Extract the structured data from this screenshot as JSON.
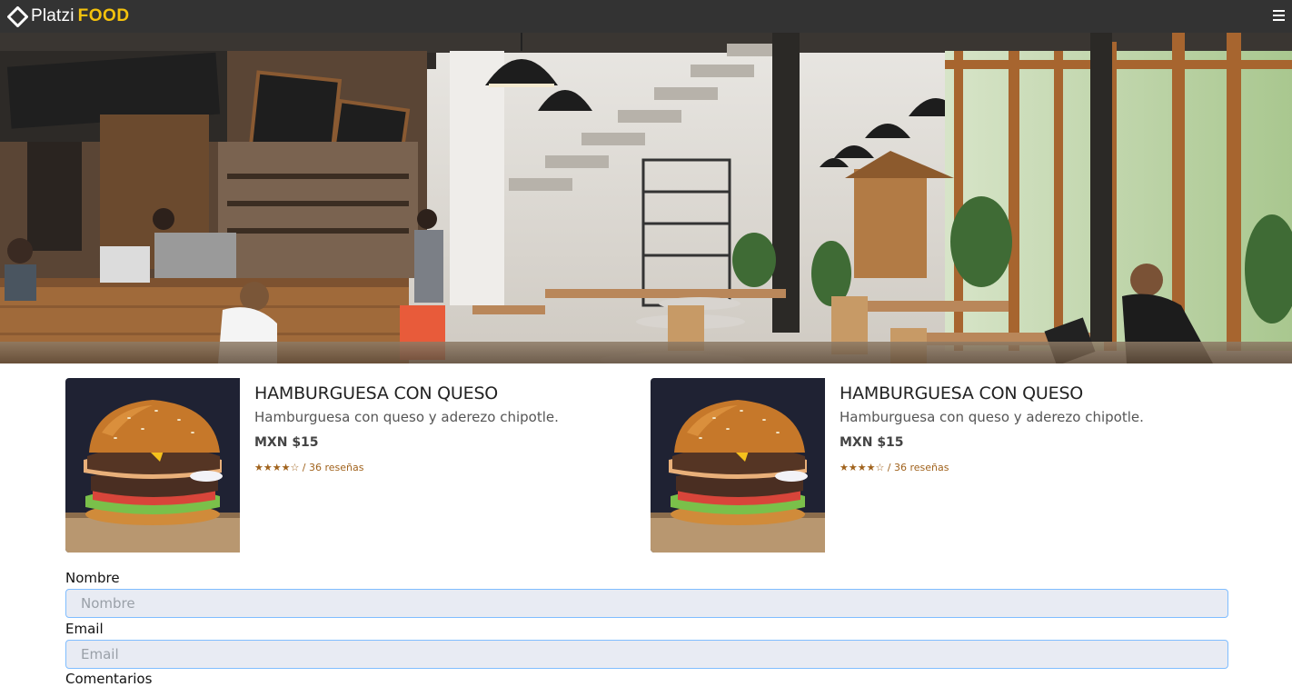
{
  "navbar": {
    "brand_platzi": "Platzi",
    "brand_food": "FOOD",
    "menu_icon": "hamburger-menu-icon"
  },
  "hero": {
    "image": "restaurant-interior-photo"
  },
  "cards": [
    {
      "image": "cheeseburger-photo",
      "title": "HAMBURGUESA CON QUESO",
      "description": "Hamburguesa con queso y aderezo chipotle.",
      "price": "MXN $15",
      "rating": "★★★★☆ / 36 reseñas"
    },
    {
      "image": "cheeseburger-photo",
      "title": "HAMBURGUESA CON QUESO",
      "description": "Hamburguesa con queso y aderezo chipotle.",
      "price": "MXN $15",
      "rating": "★★★★☆ / 36 reseñas"
    }
  ],
  "form": {
    "name_label": "Nombre",
    "name_placeholder": "Nombre",
    "email_label": "Email",
    "email_placeholder": "Email",
    "comments_label": "Comentarios"
  },
  "colors": {
    "navbar_bg": "#333333",
    "brand_accent": "#f4c20d",
    "rating_color": "#a0621c",
    "input_bg": "#e8ebf3",
    "input_border": "#80bdff"
  }
}
